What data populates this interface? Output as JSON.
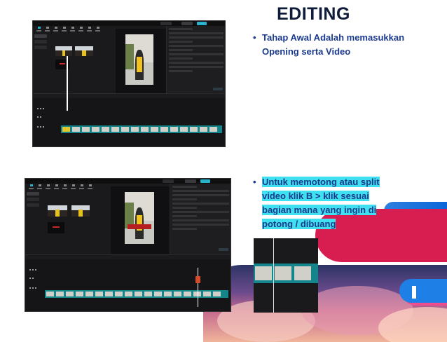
{
  "slide": {
    "title": "EDITING",
    "bullets": [
      {
        "text": "Tahap Awal Adalah memasukkan Opening serta Video"
      },
      {
        "text": "Untuk memotong atau split video klik B > klik sesuai bagian mana yang ingin di potong /  dibuang"
      }
    ]
  },
  "colors": {
    "title": "#0e1c3a",
    "bullet_text": "#1b3a8c",
    "highlight": "#3fe0f0",
    "app_bg": "#1a1a1c",
    "accent_teal": "#26b3c9",
    "track_teal": "#14858a",
    "deco_red": "#d81e50",
    "deco_blue": "#1e7fe6"
  },
  "icons": {
    "bullet": "bullet-dot-icon",
    "splitter_mark": "split-marker-icon"
  },
  "glyphs": {
    "bullet": "•"
  },
  "screenshots": {
    "first": {
      "name": "capcut-import-opening-screenshot"
    },
    "second": {
      "name": "capcut-split-video-screenshot"
    },
    "zoom": {
      "name": "split-cut-zoom-crop"
    }
  }
}
